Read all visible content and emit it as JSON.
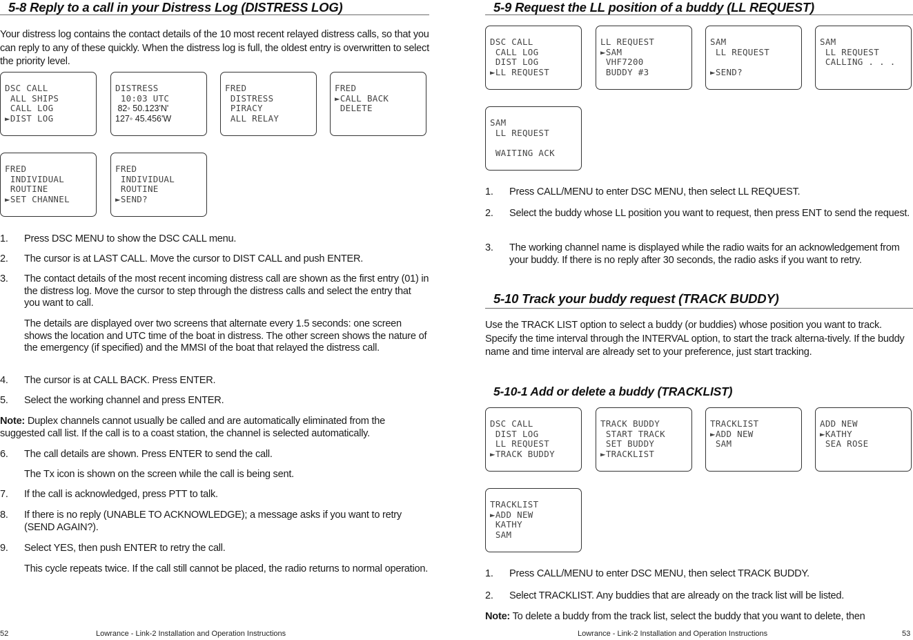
{
  "left_page": {
    "section_title": "5-8 Reply to a call in your Distress Log (DISTRESS LOG)",
    "intro": "Your distress log contains the contact details of the 10 most recent relayed distress calls, so that you can reply to any of these quickly. When the distress log is full, the oldest entry is overwritten to select the priority level.",
    "screens": [
      {
        "lines": [
          "DSC CALL",
          " ALL SHIPS",
          " CALL LOG",
          "►DIST LOG"
        ]
      },
      {
        "lines": [
          "DISTRESS",
          " 10:03 UTC",
          " 82◦ 50.123'N'",
          "127◦ 45.456'W"
        ]
      },
      {
        "lines": [
          "FRED",
          " DISTRESS",
          " PIRACY",
          " ALL RELAY"
        ]
      },
      {
        "lines": [
          "FRED",
          "►CALL BACK",
          " DELETE",
          ""
        ]
      },
      {
        "lines": [
          "FRED",
          " INDIVIDUAL",
          " ROUTINE",
          "►SET CHANNEL"
        ]
      },
      {
        "lines": [
          "FRED",
          " INDIVIDUAL",
          " ROUTINE",
          "►SEND?"
        ]
      }
    ],
    "steps": [
      {
        "num": "1.",
        "text": "Press DSC MENU to show the DSC CALL menu."
      },
      {
        "num": "2.",
        "text": "The cursor is at LAST CALL. Move the cursor to DIST CALL and push ENTER."
      },
      {
        "num": "3.",
        "text": "The contact details of the most recent incoming distress call are shown as the first entry (01) in the distress log. Move the cursor to step through the distress calls and select the entry that you want to call."
      },
      {
        "num": "",
        "text": "The details are displayed over two screens that alternate every 1.5 seconds: one screen shows the location and UTC time of the boat in distress. The other screen shows the nature of the emergency (if specified) and the MMSI of the boat that relayed the distress call."
      },
      {
        "num": "4.",
        "text": "The cursor is at CALL BACK. Press ENTER."
      },
      {
        "num": "5.",
        "text": "Select the working channel and press ENTER."
      }
    ],
    "note": {
      "label": "Note:",
      "text": " Duplex channels cannot usually be called and are automatically eliminated from the suggested call list. If the call is to a coast station, the channel is selected automatically."
    },
    "steps2": [
      {
        "num": "6.",
        "text": "The call details are shown. Press ENTER to send the call."
      },
      {
        "num": "",
        "text": "The Tx icon is shown on the screen while the call is being sent."
      },
      {
        "num": "7.",
        "text": "If the call is acknowledged, press PTT to talk."
      },
      {
        "num": "8.",
        "text": "If there is no reply (UNABLE TO ACKNOWLEDGE); a message asks if you want to retry (SEND AGAIN?)."
      },
      {
        "num": "9.",
        "text": "Select YES, then push ENTER to retry the call."
      },
      {
        "num": "",
        "text": "This cycle repeats twice. If the call still cannot be placed, the radio returns to normal operation."
      }
    ],
    "footer": {
      "page_number": "52",
      "title": "Lowrance - Link-2 Installation and Operation Instructions"
    }
  },
  "right_page": {
    "section_title": "5-9  Request the LL position of a buddy (LL REQUEST)",
    "screens": [
      {
        "lines": [
          "DSC CALL",
          " CALL LOG",
          " DIST LOG",
          "►LL REQUEST"
        ]
      },
      {
        "lines": [
          "LL REQUEST",
          "►SAM",
          " VHF7200",
          " BUDDY #3"
        ]
      },
      {
        "lines": [
          "SAM",
          " LL REQUEST",
          "",
          "►SEND?"
        ]
      },
      {
        "lines": [
          "SAM",
          " LL REQUEST",
          " CALLING . . .",
          ""
        ]
      },
      {
        "lines": [
          "SAM",
          " LL REQUEST",
          "",
          " WAITING ACK"
        ]
      }
    ],
    "steps": [
      {
        "num": "1.",
        "text": "Press CALL/MENU to enter DSC MENU, then select LL REQUEST."
      },
      {
        "num": "2.",
        "text": "Select the buddy whose LL position you want to request, then press ENT to send the request."
      },
      {
        "num": "3.",
        "text": "The working channel name is displayed while the radio waits for an acknowledgement from your buddy. If there is no reply after 30 seconds, the radio asks if you want to retry."
      }
    ],
    "section2_title": "5-10 Track your buddy request (TRACK BUDDY)",
    "section2_intro": "Use the TRACK LIST option to select a buddy (or buddies) whose position you want to track. Specify the time interval through the INTERVAL option, to start the track alterna-tively. If the buddy name and time interval are already set to your preference, just start tracking.",
    "subsection_title": "5-10-1 Add or delete a buddy (TRACKLIST)",
    "screens2": [
      {
        "lines": [
          "DSC CALL",
          " DIST LOG",
          " LL REQUEST",
          "►TRACK BUDDY"
        ]
      },
      {
        "lines": [
          "TRACK BUDDY",
          " START TRACK",
          " SET BUDDY",
          "►TRACKLIST"
        ]
      },
      {
        "lines": [
          "TRACKLIST",
          "►ADD NEW",
          " SAM",
          ""
        ]
      },
      {
        "lines": [
          "ADD NEW",
          "►KATHY",
          " SEA ROSE",
          ""
        ]
      },
      {
        "lines": [
          "TRACKLIST",
          "►ADD NEW",
          " KATHY",
          " SAM"
        ]
      }
    ],
    "steps2": [
      {
        "num": "1.",
        "text": "Press CALL/MENU to enter DSC MENU, then select TRACK BUDDY."
      },
      {
        "num": "2.",
        "text": "Select TRACKLIST. Any buddies that are already on the track list will be listed."
      }
    ],
    "note": {
      "label": "Note:",
      "text": " To delete a buddy from the track list, select the buddy that you want to delete, then"
    },
    "footer": {
      "page_number": "53",
      "title": "Lowrance - Link-2 Installation and Operation Instructions"
    }
  }
}
